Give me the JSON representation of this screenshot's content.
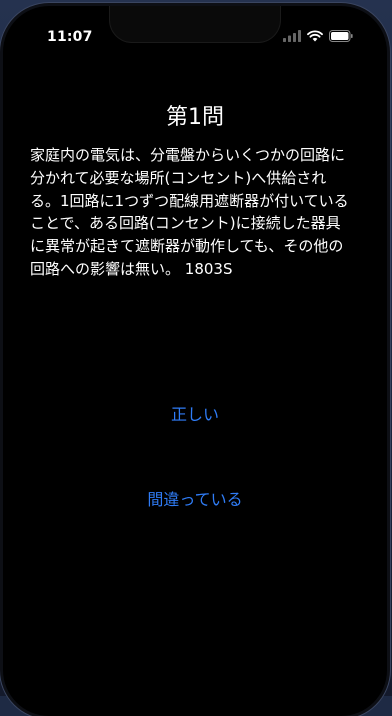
{
  "status_bar": {
    "time": "11:07",
    "signal_icon": "signal-icon",
    "wifi_icon": "wifi-icon",
    "battery_icon": "battery-icon"
  },
  "quiz": {
    "title": "第1問",
    "question": "家庭内の電気は、分電盤からいくつかの回路に分かれて必要な場所(コンセント)へ供給される。1回路に1つずつ配線用遮断器が付いていることで、ある回路(コンセント)に接続した器具に異常が起きて遮断器が動作しても、その他の回路への影響は無い。 1803S",
    "answer_true": "正しい",
    "answer_false": "間違っている"
  },
  "colors": {
    "accent": "#2f7cf6",
    "background": "#000000",
    "text": "#ffffff"
  }
}
